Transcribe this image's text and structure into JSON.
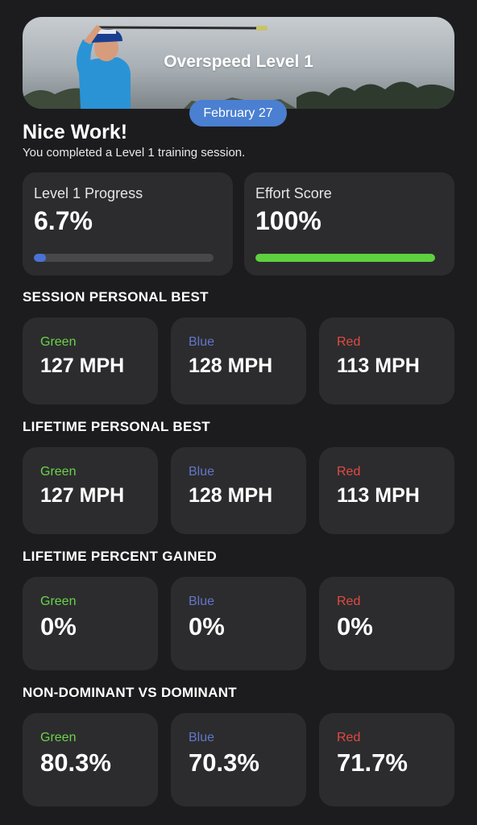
{
  "banner": {
    "title": "Overspeed Level 1"
  },
  "date": "February 27",
  "headline": "Nice Work!",
  "subline": "You completed a Level 1 training session.",
  "progress_card": {
    "label": "Level 1 Progress",
    "value": "6.7%",
    "fill_percent": 6.7,
    "color": "#4a72d6"
  },
  "effort_card": {
    "label": "Effort Score",
    "value": "100%",
    "fill_percent": 100,
    "color": "#5ed13f"
  },
  "sections": [
    {
      "title": "SESSION PERSONAL BEST",
      "cards": [
        {
          "label": "Green",
          "value": "127 MPH"
        },
        {
          "label": "Blue",
          "value": "128 MPH"
        },
        {
          "label": "Red",
          "value": "113 MPH"
        }
      ]
    },
    {
      "title": "LIFETIME PERSONAL BEST",
      "cards": [
        {
          "label": "Green",
          "value": "127 MPH"
        },
        {
          "label": "Blue",
          "value": "128 MPH"
        },
        {
          "label": "Red",
          "value": "113 MPH"
        }
      ]
    },
    {
      "title": "LIFETIME PERCENT GAINED",
      "cards": [
        {
          "label": "Green",
          "value": "0%"
        },
        {
          "label": "Blue",
          "value": "0%"
        },
        {
          "label": "Red",
          "value": "0%"
        }
      ]
    },
    {
      "title": "NON-DOMINANT VS DOMINANT",
      "cards": [
        {
          "label": "Green",
          "value": "80.3%"
        },
        {
          "label": "Blue",
          "value": "70.3%"
        },
        {
          "label": "Red",
          "value": "71.7%"
        }
      ]
    }
  ],
  "colors": {
    "green": "#6bd34a",
    "blue": "#6277c9",
    "red": "#e24a40"
  }
}
